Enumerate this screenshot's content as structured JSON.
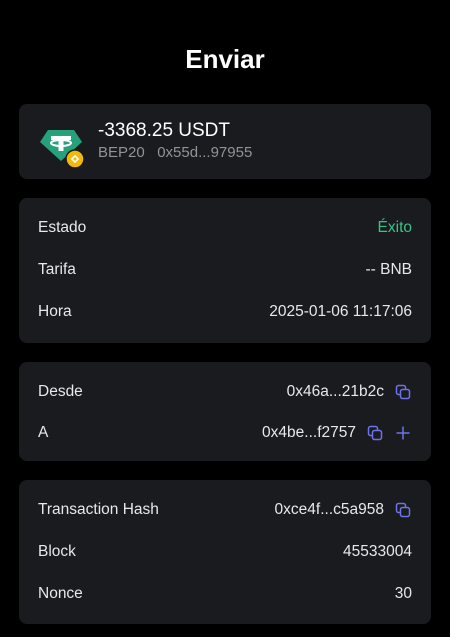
{
  "header": {
    "title": "Enviar"
  },
  "token": {
    "icon": "tether-usdt-icon",
    "badge_icon": "bnb-chain-badge-icon",
    "amount": "-3368.25 USDT",
    "network_address": "BEP20   0x55d...97955"
  },
  "details": {
    "status_label": "Estado",
    "status_value": "Éxito",
    "fee_label": "Tarifa",
    "fee_value": "-- BNB",
    "time_label": "Hora",
    "time_value": "2025-01-06 11:17:06"
  },
  "addresses": {
    "from_label": "Desde",
    "from_value": "0x46a...21b2c",
    "to_label": "A",
    "to_value": "0x4be...f2757"
  },
  "transaction": {
    "hash_label": "Transaction Hash",
    "hash_value": "0xce4f...c5a958",
    "block_label": "Block",
    "block_value": "45533004",
    "nonce_label": "Nonce",
    "nonce_value": "30"
  },
  "colors": {
    "background": "#000000",
    "card": "#1a1b1e",
    "success": "#37c28a",
    "accent_icon": "#6e72e8",
    "tether": "#26a17b",
    "bnb": "#f0b90b"
  }
}
